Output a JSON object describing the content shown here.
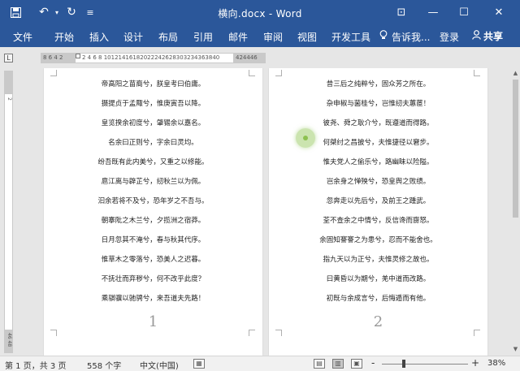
{
  "titlebar": {
    "title": "横向.docx - Word",
    "save_icon": "💾",
    "undo_icon": "↶",
    "redo_icon": "↻",
    "customize_icon": "≡",
    "ribbon_display_icon": "⊡",
    "minimize_icon": "—",
    "maximize_icon": "☐",
    "close_icon": "✕"
  },
  "ribbon": {
    "tabs": [
      "文件",
      "开始",
      "插入",
      "设计",
      "布局",
      "引用",
      "邮件",
      "审阅",
      "视图",
      "开发工具"
    ],
    "tell_me": "告诉我...",
    "login": "登录",
    "share": "共享"
  },
  "ruler": {
    "corner": "L",
    "left_numbers": "8 6 4 2",
    "numbers": "2  4  6  8 10121416182022242628303234363840",
    "right_numbers": "424446"
  },
  "pages": [
    {
      "number": "1",
      "lines": [
        "帝高阳之苗裔兮，朕皇考曰伯庸。",
        "摄提贞于孟陬兮，惟庚寅吾以降。",
        "皇览揆余初度兮，肇锡余以嘉名。",
        "名余曰正则兮，字余曰灵均。",
        "纷吾既有此内美兮，又重之以修能。",
        "扈江离与辟芷兮，纫秋兰以为佩。",
        "汩余若将不及兮，恐年岁之不吾与。",
        "朝搴阰之木兰兮，夕揽洲之宿莽。",
        "日月忽其不淹兮，春与秋其代序。",
        "惟草木之零落兮，恐美人之迟暮。",
        "不抚壮而弃秽兮，何不改乎此度？",
        "乘骐骥以驰骋兮，来吾道夫先路！"
      ]
    },
    {
      "number": "2",
      "lines": [
        "昔三后之纯粹兮，固众芳之所在。",
        "杂申椒与菌桂兮，岂惟纫夫蕙茝！",
        "彼尧、舜之耿介兮，既遵道而得路。",
        "何桀纣之昌披兮，夫惟捷径以窘步。",
        "惟夫党人之偷乐兮，路幽昧以险隘。",
        "岂余身之惮殃兮，恐皇舆之败绩。",
        "忽奔走以先后兮，及前王之踵武。",
        "荃不查余之中情兮，反信谗而齌怒。",
        "余固知謇謇之为患兮，忍而不能舍也。",
        "指九天以为正兮，夫惟灵修之故也。",
        "曰黄昏以为期兮，羌中道而改路。",
        "初既与余成言兮，后悔遁而有他。"
      ]
    }
  ],
  "vruler": {
    "top_num": "2",
    "bottom_num": "46 48"
  },
  "statusbar": {
    "page_info": "第 1 页，共 3 页",
    "word_count": "558 个字",
    "language": "中文(中国)",
    "zoom_minus": "-",
    "zoom_plus": "+",
    "zoom_level": "38%",
    "zoom_fraction": 0.38
  },
  "colors": {
    "ribbon": "#2b579a",
    "workspace": "#e6e6e6",
    "cursor_highlight": "#8cc14f"
  }
}
